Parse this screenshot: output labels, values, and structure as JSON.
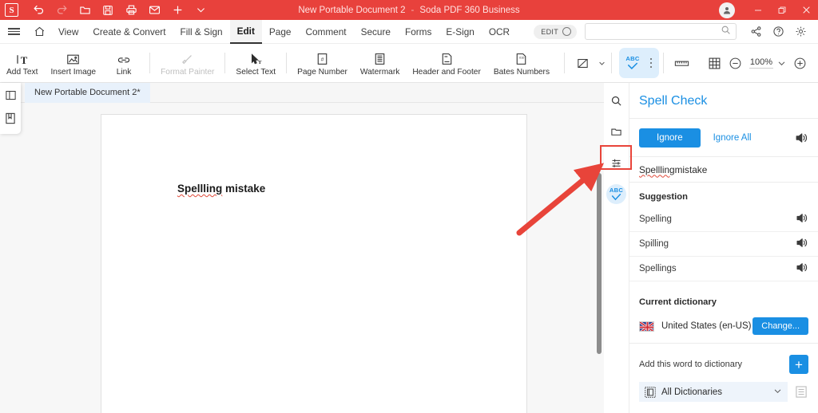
{
  "titlebar": {
    "logo": "S",
    "doc_title": "New Portable Document 2",
    "separator": "-",
    "app_name": "Soda PDF 360 Business",
    "icons": [
      "undo-icon",
      "redo-icon",
      "open-folder-icon",
      "save-icon",
      "print-icon",
      "email-icon",
      "new-tab-icon",
      "chevron-down-icon"
    ],
    "window": [
      "account-icon",
      "minimize-icon",
      "restore-icon",
      "close-icon"
    ]
  },
  "menubar": {
    "hamburger": "hamburger-icon",
    "home": "home-icon",
    "items": [
      {
        "label": "View",
        "active": false
      },
      {
        "label": "Create & Convert",
        "active": false
      },
      {
        "label": "Fill & Sign",
        "active": false
      },
      {
        "label": "Edit",
        "active": true
      },
      {
        "label": "Page",
        "active": false
      },
      {
        "label": "Comment",
        "active": false
      },
      {
        "label": "Secure",
        "active": false
      },
      {
        "label": "Forms",
        "active": false
      },
      {
        "label": "E-Sign",
        "active": false
      },
      {
        "label": "OCR",
        "active": false
      }
    ],
    "edit_toggle": "EDIT",
    "search_placeholder": "",
    "search_value": "",
    "right_icons": [
      "share-icon",
      "help-icon",
      "gear-icon"
    ]
  },
  "ribbon": {
    "buttons": [
      {
        "label": "Add Text",
        "icon": "add-text-icon",
        "disabled": false
      },
      {
        "label": "Insert Image",
        "icon": "insert-image-icon",
        "disabled": false
      },
      {
        "label": "Link",
        "icon": "link-icon",
        "disabled": false
      },
      {
        "label": "Format Painter",
        "icon": "format-painter-icon",
        "disabled": true
      },
      {
        "label": "Select Text",
        "icon": "select-text-icon",
        "disabled": false
      },
      {
        "label": "Page Number",
        "icon": "page-number-icon",
        "disabled": false
      },
      {
        "label": "Watermark",
        "icon": "watermark-icon",
        "disabled": false
      },
      {
        "label": "Header and Footer",
        "icon": "header-footer-icon",
        "disabled": false
      },
      {
        "label": "Bates Numbers",
        "icon": "bates-numbers-icon",
        "disabled": false
      }
    ],
    "abc_label": "ABC",
    "tool_icons": [
      "redact-icon",
      "spell-check-icon",
      "more-options-icon",
      "ruler-icon",
      "grid-icon"
    ],
    "zoom": {
      "minus": "zoom-out-icon",
      "value": "100%",
      "chevron": "chevron-down-icon",
      "plus": "zoom-in-icon"
    }
  },
  "left_rail": {
    "icons": [
      "panel-toggle-icon",
      "bookmark-icon"
    ]
  },
  "tabstrip": {
    "tabs": [
      {
        "label": "New Portable Document 2*",
        "active": true
      }
    ]
  },
  "document": {
    "text_misspelled": "Spellling",
    "text_rest": " mistake"
  },
  "side_rail": {
    "icons": [
      "search-icon",
      "folder-icon",
      "sliders-icon",
      "spell-check-abc-icon"
    ],
    "abc_label": "ABC"
  },
  "panel": {
    "title": "Spell Check",
    "ignore_label": "Ignore",
    "ignore_all_label": "Ignore All",
    "speak_icon": "speaker-icon",
    "current_word_misspelled": "Spellling",
    "current_word_rest": " mistake",
    "suggestion_header": "Suggestion",
    "suggestions": [
      {
        "word": "Spelling",
        "icon": "speaker-icon"
      },
      {
        "word": "Spilling",
        "icon": "speaker-icon"
      },
      {
        "word": "Spellings",
        "icon": "speaker-icon"
      }
    ],
    "dictionary_header": "Current dictionary",
    "dictionary_name": "United States (en-US)",
    "dictionary_flag": "us-flag-icon",
    "change_label": "Change...",
    "add_word_label": "Add this word to dictionary",
    "add_button": "+",
    "dict_select_value": "All Dictionaries",
    "dict_select_icon": "dictionary-icon",
    "dict_list_icon": "list-icon"
  },
  "annotation": {
    "highlight_color": "#e8443a",
    "arrow_color": "#e8443a",
    "target": "spell-check-abc-icon"
  },
  "colors": {
    "titlebar": "#e8413c",
    "accent_blue": "#1a8fe3",
    "panel_bg": "#ffffff",
    "doc_bg": "#f7f7f7",
    "misspell_underline": "#e04a3a"
  }
}
